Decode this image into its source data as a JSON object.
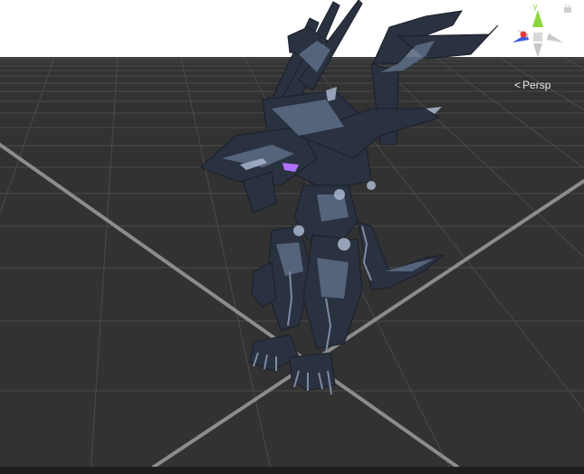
{
  "scene_view": {
    "projection_label": "Persp",
    "axes": {
      "y": {
        "label": "y",
        "color": "#8ad63a"
      },
      "x": {
        "color": "#e23b3b"
      },
      "z": {
        "color": "#3a5be0"
      }
    },
    "icons": {
      "projection_toggle": "chevron-left-icon",
      "orientation_gizmo": "axis-gizmo-icon",
      "lock": "lock-icon"
    }
  },
  "colors": {
    "sky": "#ffffff",
    "ground": "#323232",
    "grid_line": "#4a4a4a",
    "grid_axis": "#8c8c8c",
    "model_dark": "#2a3140",
    "model_mid": "#5a6a82",
    "model_light": "#a9b6cc",
    "model_glow": "#b070ff"
  }
}
